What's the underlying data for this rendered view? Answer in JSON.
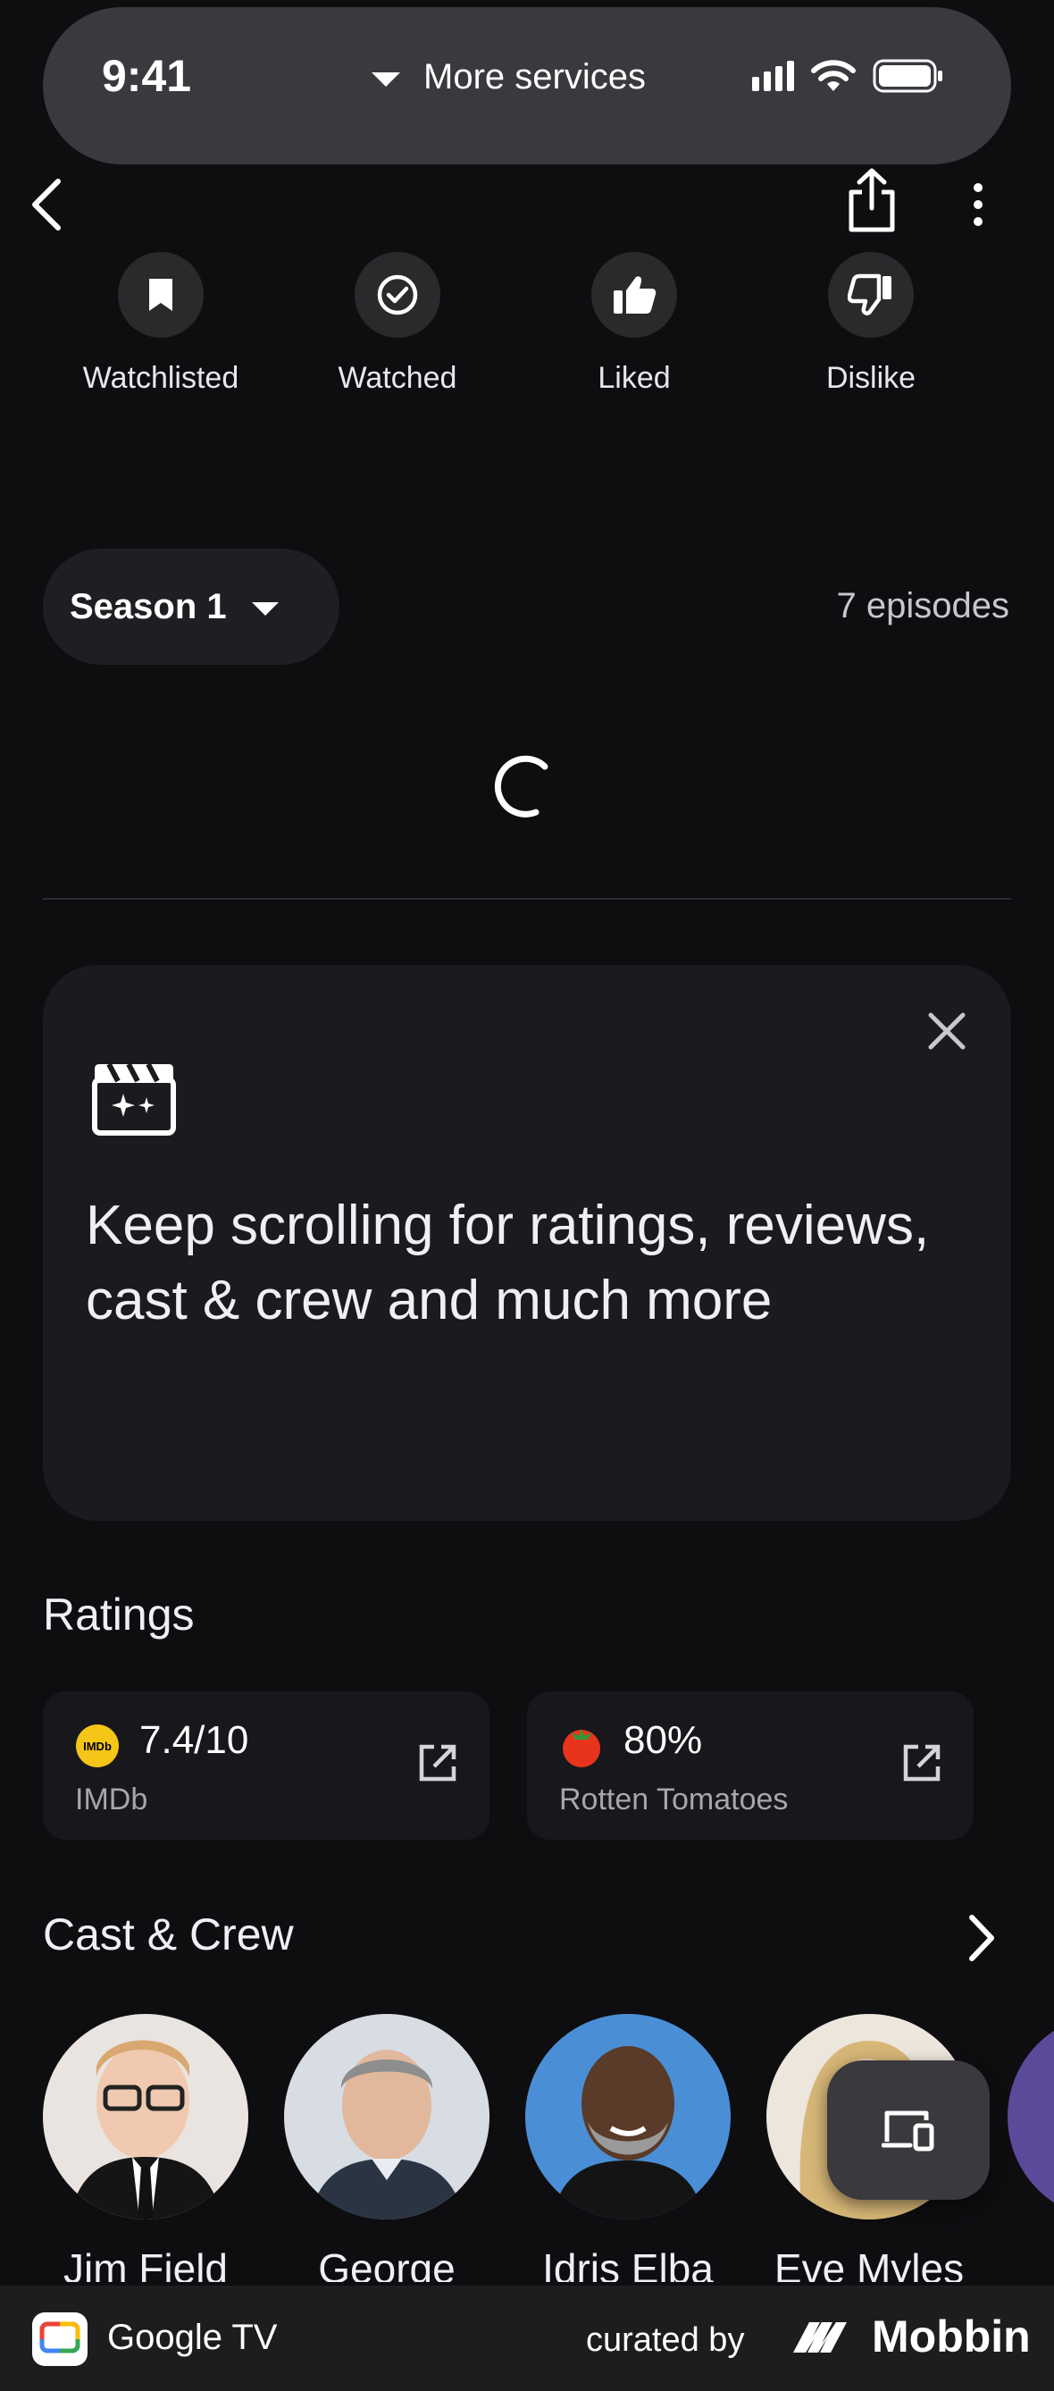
{
  "status_bar": {
    "time": "9:41",
    "service_label": "More services"
  },
  "toolbar": {
    "back_icon": "chevron-left-icon",
    "share_icon": "share-icon",
    "more_icon": "more-vert-icon"
  },
  "actions": [
    {
      "label": "Watchlisted",
      "icon": "bookmark-icon"
    },
    {
      "label": "Watched",
      "icon": "check-circle-icon"
    },
    {
      "label": "Liked",
      "icon": "thumb-up-icon"
    },
    {
      "label": "Dislike",
      "icon": "thumb-down-icon"
    }
  ],
  "season": {
    "selected": "Season 1",
    "episodes": "7 episodes"
  },
  "tip_card": {
    "text": "Keep scrolling for ratings, reviews, cast & crew and much more",
    "icon": "clapperboard-sparkle-icon"
  },
  "ratings": {
    "title": "Ratings",
    "items": [
      {
        "score": "7.4/10",
        "source": "IMDb",
        "logo_text": "IMDb"
      },
      {
        "score": "80%",
        "source": "Rotten Tomatoes",
        "logo_text": ""
      }
    ]
  },
  "cast": {
    "title": "Cast & Crew",
    "people": [
      {
        "name": "Jim Field"
      },
      {
        "name": "George"
      },
      {
        "name": "Idris Elba"
      },
      {
        "name": "Eve Myles"
      }
    ]
  },
  "footer": {
    "app_name": "Google TV",
    "curated_by": "curated by",
    "brand": "Mobbin"
  },
  "colors": {
    "background": "#0e0d10",
    "surface": "#1b1a1e",
    "imdb_yellow": "#f5c518",
    "tomato_red": "#e8341c"
  }
}
